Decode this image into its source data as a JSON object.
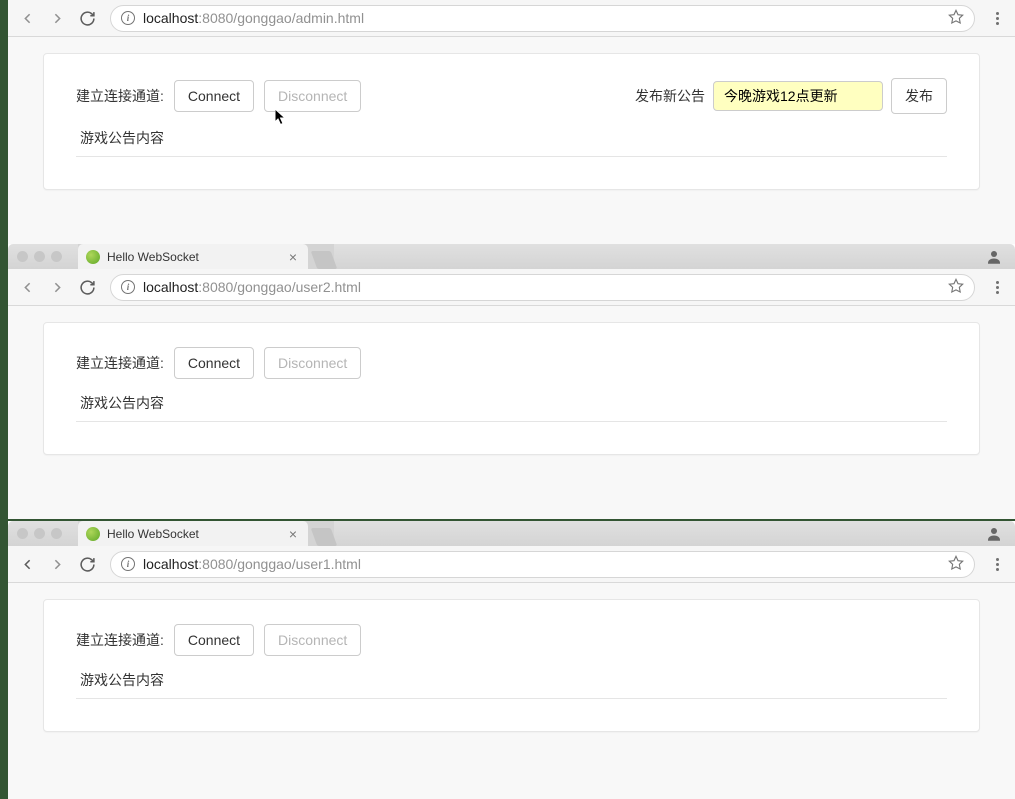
{
  "window1": {
    "nav": {
      "url_prefix": "localhost",
      "url_suffix": ":8080/gonggao/admin.html"
    },
    "page": {
      "connect_label": "建立连接通道:",
      "connect_btn": "Connect",
      "disconnect_btn": "Disconnect",
      "publish_label": "发布新公告",
      "input_value": "今晚游戏12点更新",
      "publish_btn": "发布",
      "content_title": "游戏公告内容"
    }
  },
  "window2": {
    "tab_title": "Hello WebSocket",
    "nav": {
      "url_prefix": "localhost",
      "url_suffix": ":8080/gonggao/user2.html"
    },
    "page": {
      "connect_label": "建立连接通道:",
      "connect_btn": "Connect",
      "disconnect_btn": "Disconnect",
      "content_title": "游戏公告内容"
    }
  },
  "window3": {
    "tab_title": "Hello WebSocket",
    "nav": {
      "url_prefix": "localhost",
      "url_suffix": ":8080/gonggao/user1.html"
    },
    "page": {
      "connect_label": "建立连接通道:",
      "connect_btn": "Connect",
      "disconnect_btn": "Disconnect",
      "content_title": "游戏公告内容"
    }
  }
}
